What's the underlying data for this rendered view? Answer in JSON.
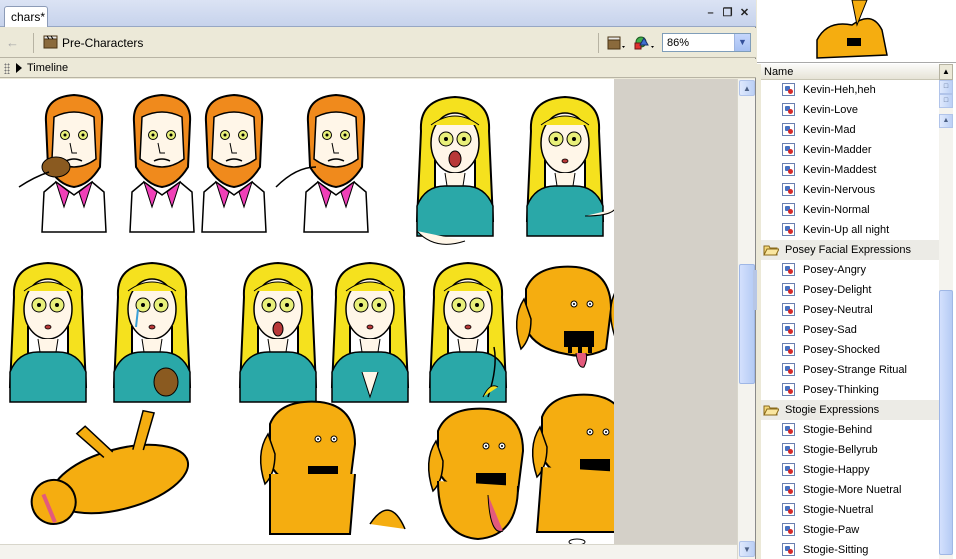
{
  "document": {
    "tab_title": "chars*",
    "scene_name": "Pre-Characters",
    "zoom_value": "86%",
    "timeline_label": "Timeline"
  },
  "library": {
    "column_name": "Name",
    "items": [
      {
        "type": "symbol",
        "label": "Kevin-Heh,heh"
      },
      {
        "type": "symbol",
        "label": "Kevin-Love"
      },
      {
        "type": "symbol",
        "label": "Kevin-Mad"
      },
      {
        "type": "symbol",
        "label": "Kevin-Madder"
      },
      {
        "type": "symbol",
        "label": "Kevin-Maddest"
      },
      {
        "type": "symbol",
        "label": "Kevin-Nervous"
      },
      {
        "type": "symbol",
        "label": "Kevin-Normal"
      },
      {
        "type": "symbol",
        "label": "Kevin-Up all night"
      },
      {
        "type": "folder",
        "label": "Posey Facial Expressions"
      },
      {
        "type": "symbol",
        "label": "Posey-Angry"
      },
      {
        "type": "symbol",
        "label": "Posey-Delight"
      },
      {
        "type": "symbol",
        "label": "Posey-Neutral"
      },
      {
        "type": "symbol",
        "label": "Posey-Sad"
      },
      {
        "type": "symbol",
        "label": "Posey-Shocked"
      },
      {
        "type": "symbol",
        "label": "Posey-Strange Ritual"
      },
      {
        "type": "symbol",
        "label": "Posey-Thinking"
      },
      {
        "type": "folder",
        "label": "Stogie Expressions"
      },
      {
        "type": "symbol",
        "label": "Stogie-Behind"
      },
      {
        "type": "symbol",
        "label": "Stogie-Bellyrub"
      },
      {
        "type": "symbol",
        "label": "Stogie-Happy"
      },
      {
        "type": "symbol",
        "label": "Stogie-More Nuetral"
      },
      {
        "type": "symbol",
        "label": "Stogie-Nuetral"
      },
      {
        "type": "symbol",
        "label": "Stogie-Paw"
      },
      {
        "type": "symbol",
        "label": "Stogie-Sitting"
      }
    ]
  },
  "colors": {
    "hair_orange": "#f08a1c",
    "hair_blonde": "#f5e11e",
    "shirt_teal": "#2aa8a8",
    "collar_pink": "#f040b8",
    "dog_orange": "#f5ad10",
    "skin": "#fff6e8"
  }
}
